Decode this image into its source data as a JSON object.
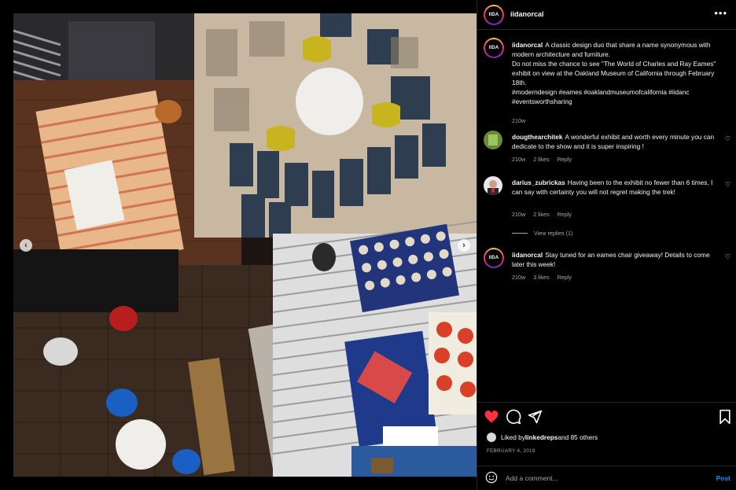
{
  "post": {
    "username": "iidanorcal",
    "avatar_logo": "IIDA",
    "more_icon": "more-horizontal-icon"
  },
  "comments": [
    {
      "username": "iidanorcal",
      "text": "A classic design duo that share a name synonymous with modern architecture and furniture.\nDo not miss the chance to see \"The World of Charles and Ray Eames\" exhibit on view at the Oakland Museum of California through February 18th.\n#moderndesign #eames #oaklandmuseumofcalifornia #iidanc #eventsworthsharing",
      "time": "210w"
    },
    {
      "username": "dougthearchitek",
      "text": "A wonderful exhibit and worth every minute you can dedicate to the show and it is super inspiring !",
      "time": "210w",
      "likes": "2 likes",
      "reply": "Reply"
    },
    {
      "username": "darius_zubrickas",
      "text": "Having been to the exhibit no fewer than 6 times, I can say with certainty you will not regret making the trek!",
      "time": "210w",
      "likes": "2 likes",
      "reply": "Reply",
      "view_replies": "View replies (1)"
    },
    {
      "username": "iidanorcal",
      "text": "Stay tuned for an eames chair giveaway! Details to come later this week!",
      "time": "210w",
      "likes": "3 likes",
      "reply": "Reply"
    }
  ],
  "actions": {
    "liked_prefix": "Liked by ",
    "liked_user": "linkedreps",
    "liked_suffix": " and 85 others",
    "date": "FEBRUARY 4, 2019"
  },
  "compose": {
    "placeholder": "Add a comment...",
    "post_label": "Post"
  },
  "colors": {
    "accent": "#0095f6",
    "like_red": "#ff3040",
    "muted": "#a8a8a8"
  },
  "media": {
    "prev_icon": "chevron-left-icon",
    "next_icon": "chevron-right-icon"
  }
}
